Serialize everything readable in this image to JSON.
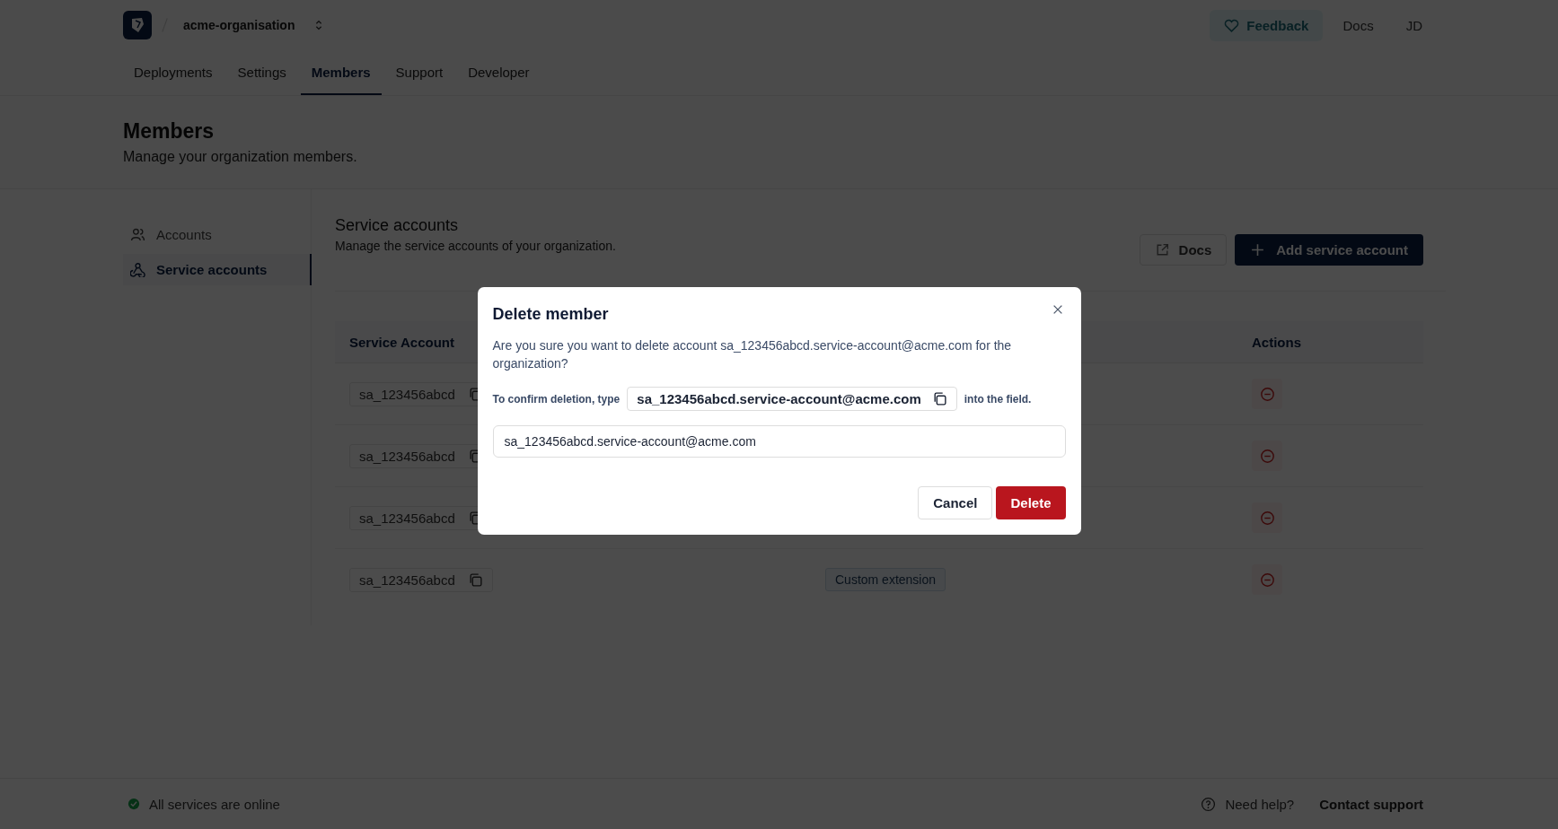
{
  "org": {
    "name": "acme-organisation"
  },
  "header_actions": {
    "feedback": "Feedback",
    "docs": "Docs",
    "avatar": "JD"
  },
  "tabs": [
    {
      "label": "Deployments",
      "selected": false
    },
    {
      "label": "Settings",
      "selected": false
    },
    {
      "label": "Members",
      "selected": true
    },
    {
      "label": "Support",
      "selected": false
    },
    {
      "label": "Developer",
      "selected": false
    }
  ],
  "page": {
    "title": "Members",
    "subtitle": "Manage your organization members."
  },
  "sidebar": {
    "items": [
      {
        "label": "Accounts",
        "kind": "users",
        "selected": false
      },
      {
        "label": "Service accounts",
        "kind": "webhook",
        "selected": true
      }
    ]
  },
  "section": {
    "title": "Service accounts",
    "subtitle": "Manage the service accounts of your organization.",
    "docs_button": "Docs",
    "add_button": "Add service account"
  },
  "table": {
    "columns": [
      "Service Account",
      "Actions"
    ],
    "rows": [
      {
        "account": "sa_123456abcd"
      },
      {
        "account": "sa_123456abcd"
      },
      {
        "account": "sa_123456abcd"
      },
      {
        "account": "sa_123456abcd",
        "tag": "Custom extension"
      }
    ]
  },
  "dialog": {
    "title": "Delete member",
    "message": "Are you sure you want to delete account sa_123456abcd.service-account@acme.com for the organization?",
    "confirm_prefix": "To confirm deletion, type",
    "confirm_code": "sa_123456abcd.service-account@acme.com",
    "confirm_suffix": "into the field.",
    "input_value": "sa_123456abcd.service-account@acme.com",
    "cancel": "Cancel",
    "delete": "Delete"
  },
  "footer": {
    "status": "All services are online",
    "help": "Need help?",
    "contact": "Contact support"
  }
}
